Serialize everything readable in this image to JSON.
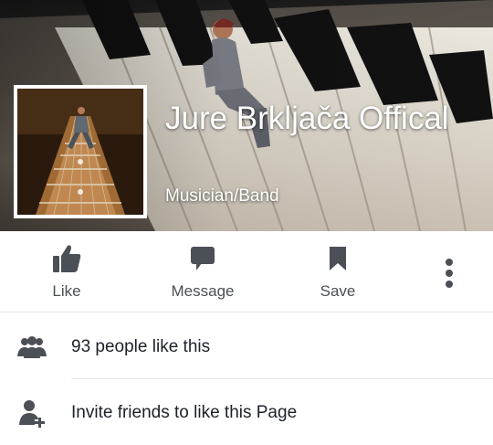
{
  "page": {
    "name": "Jure Brkljača Offical",
    "category": "Musician/Band"
  },
  "actions": [
    {
      "label": "Like",
      "icon": "thumbs-up-icon"
    },
    {
      "label": "Message",
      "icon": "message-icon"
    },
    {
      "label": "Save",
      "icon": "bookmark-icon"
    }
  ],
  "more_icon": "more-vertical-icon",
  "rows": {
    "likes": {
      "text": "93 people like this",
      "icon": "people-icon"
    },
    "invite": {
      "text": "Invite friends to like this Page",
      "icon": "add-friend-icon"
    }
  },
  "colors": {
    "icon": "#4b4f56",
    "text": "#1d2129",
    "divider": "#e5e6e9"
  }
}
